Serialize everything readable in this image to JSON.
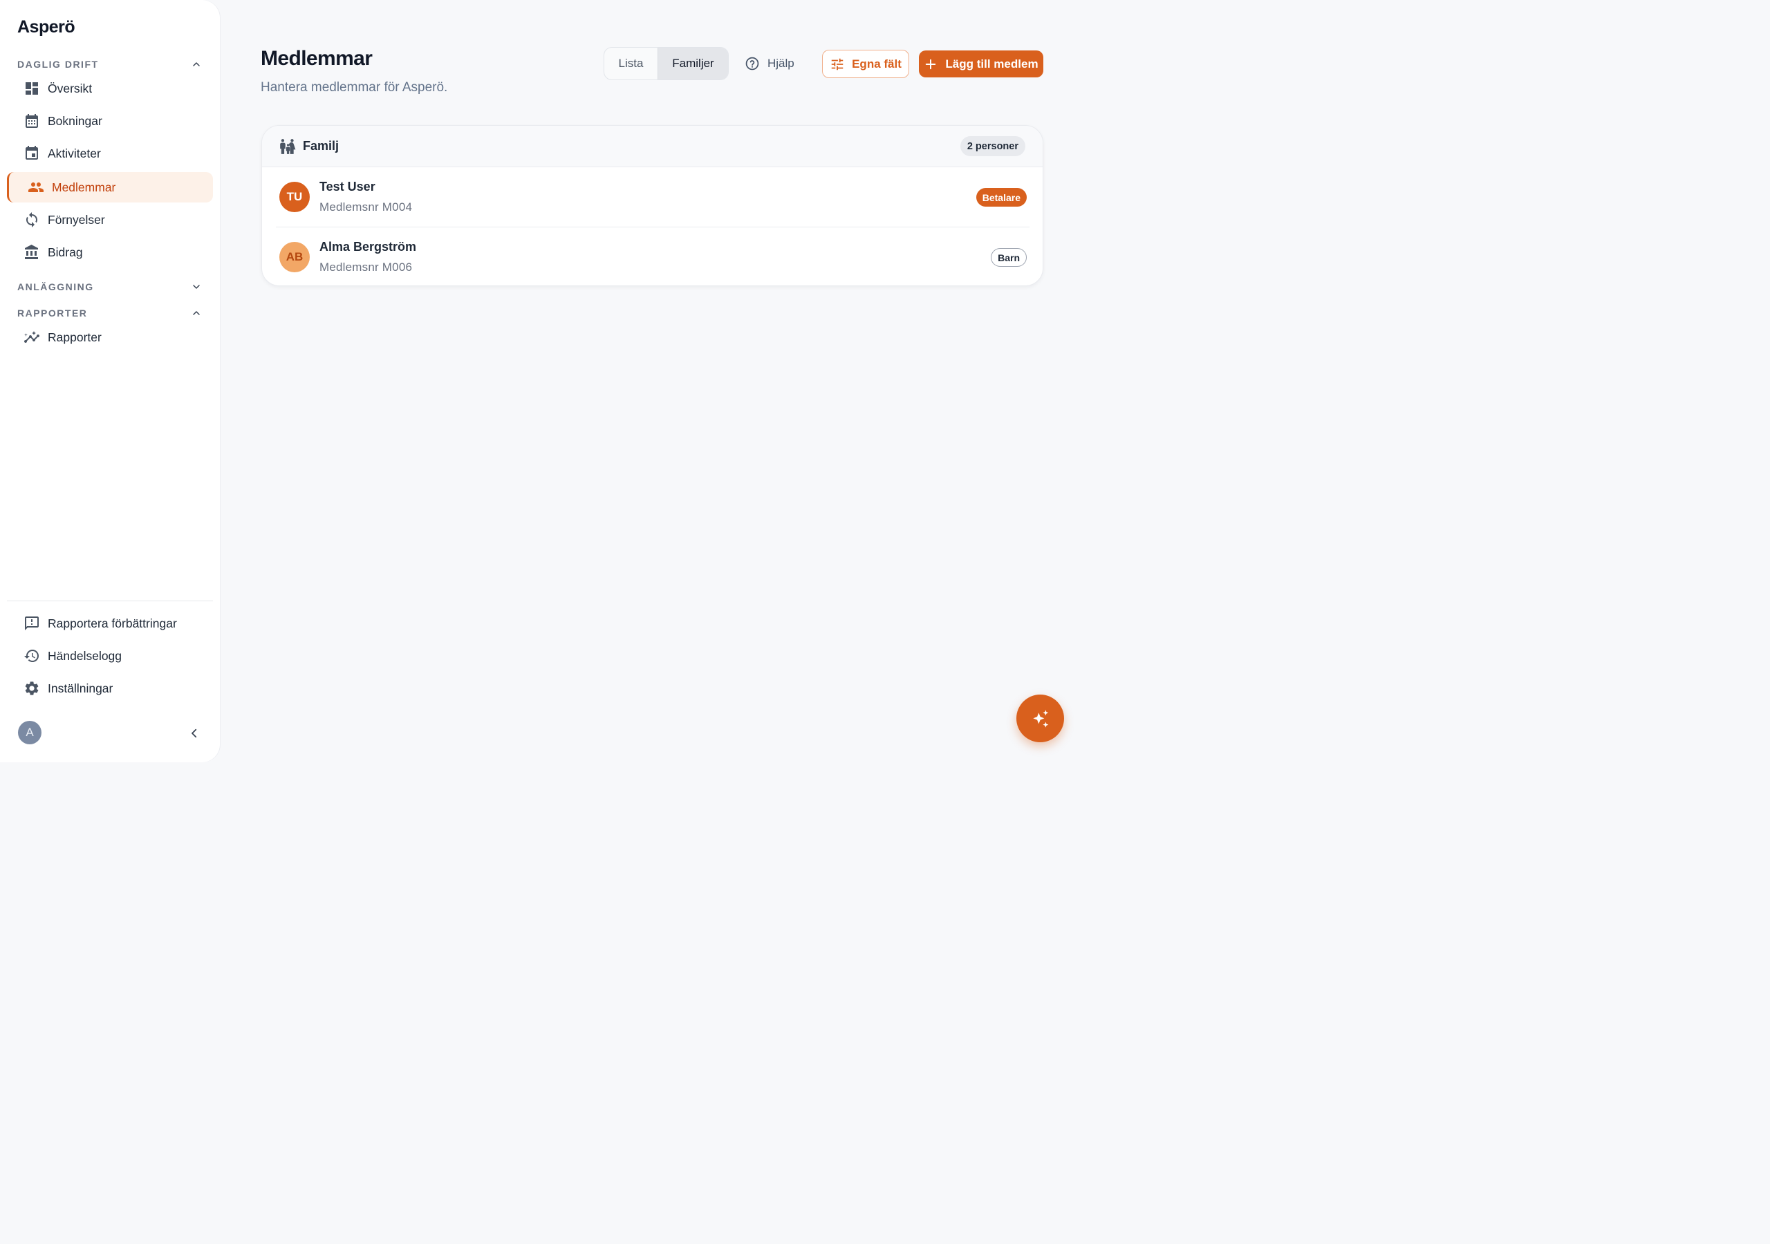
{
  "app": {
    "brand": "Asperö"
  },
  "sidebar": {
    "sections": [
      {
        "title": "DAGLIG DRIFT",
        "expanded": true
      },
      {
        "title": "ANLÄGGNING",
        "expanded": false
      },
      {
        "title": "RAPPORTER",
        "expanded": true
      }
    ],
    "items": [
      {
        "label": "Översikt",
        "icon": "dashboard-icon"
      },
      {
        "label": "Bokningar",
        "icon": "calendar-icon"
      },
      {
        "label": "Aktiviteter",
        "icon": "event-icon"
      },
      {
        "label": "Medlemmar",
        "icon": "people-icon",
        "active": true
      },
      {
        "label": "Förnyelser",
        "icon": "refresh-icon"
      },
      {
        "label": "Bidrag",
        "icon": "bank-icon"
      },
      {
        "label": "Rapporter",
        "icon": "trending-icon"
      }
    ],
    "footer_items": [
      {
        "label": "Rapportera förbättringar",
        "icon": "feedback-icon"
      },
      {
        "label": "Händelselogg",
        "icon": "history-icon"
      },
      {
        "label": "Inställningar",
        "icon": "gear-icon"
      }
    ],
    "user_initial": "A"
  },
  "header": {
    "title": "Medlemmar",
    "subtitle": "Hantera medlemmar för Asperö.",
    "view_toggle": {
      "options": [
        "Lista",
        "Familjer"
      ],
      "selected": "Familjer"
    },
    "help_label": "Hjälp",
    "custom_fields_label": "Egna fält",
    "add_member_label": "Lägg till medlem"
  },
  "family": {
    "name": "Familj",
    "count_label": "2 personer",
    "members": [
      {
        "initials": "TU",
        "name": "Test User",
        "member_no": "Medlemsnr M004",
        "role": "Betalare",
        "avatar_bg": "#d9601d",
        "avatar_fg": "#ffffff"
      },
      {
        "initials": "AB",
        "name": "Alma Bergström",
        "member_no": "Medlemsnr M006",
        "role": "Barn",
        "avatar_bg": "#f2a766",
        "avatar_fg": "#b4470f"
      }
    ]
  },
  "colors": {
    "accent": "#d9601d",
    "accent_light": "#fdf1e8"
  }
}
